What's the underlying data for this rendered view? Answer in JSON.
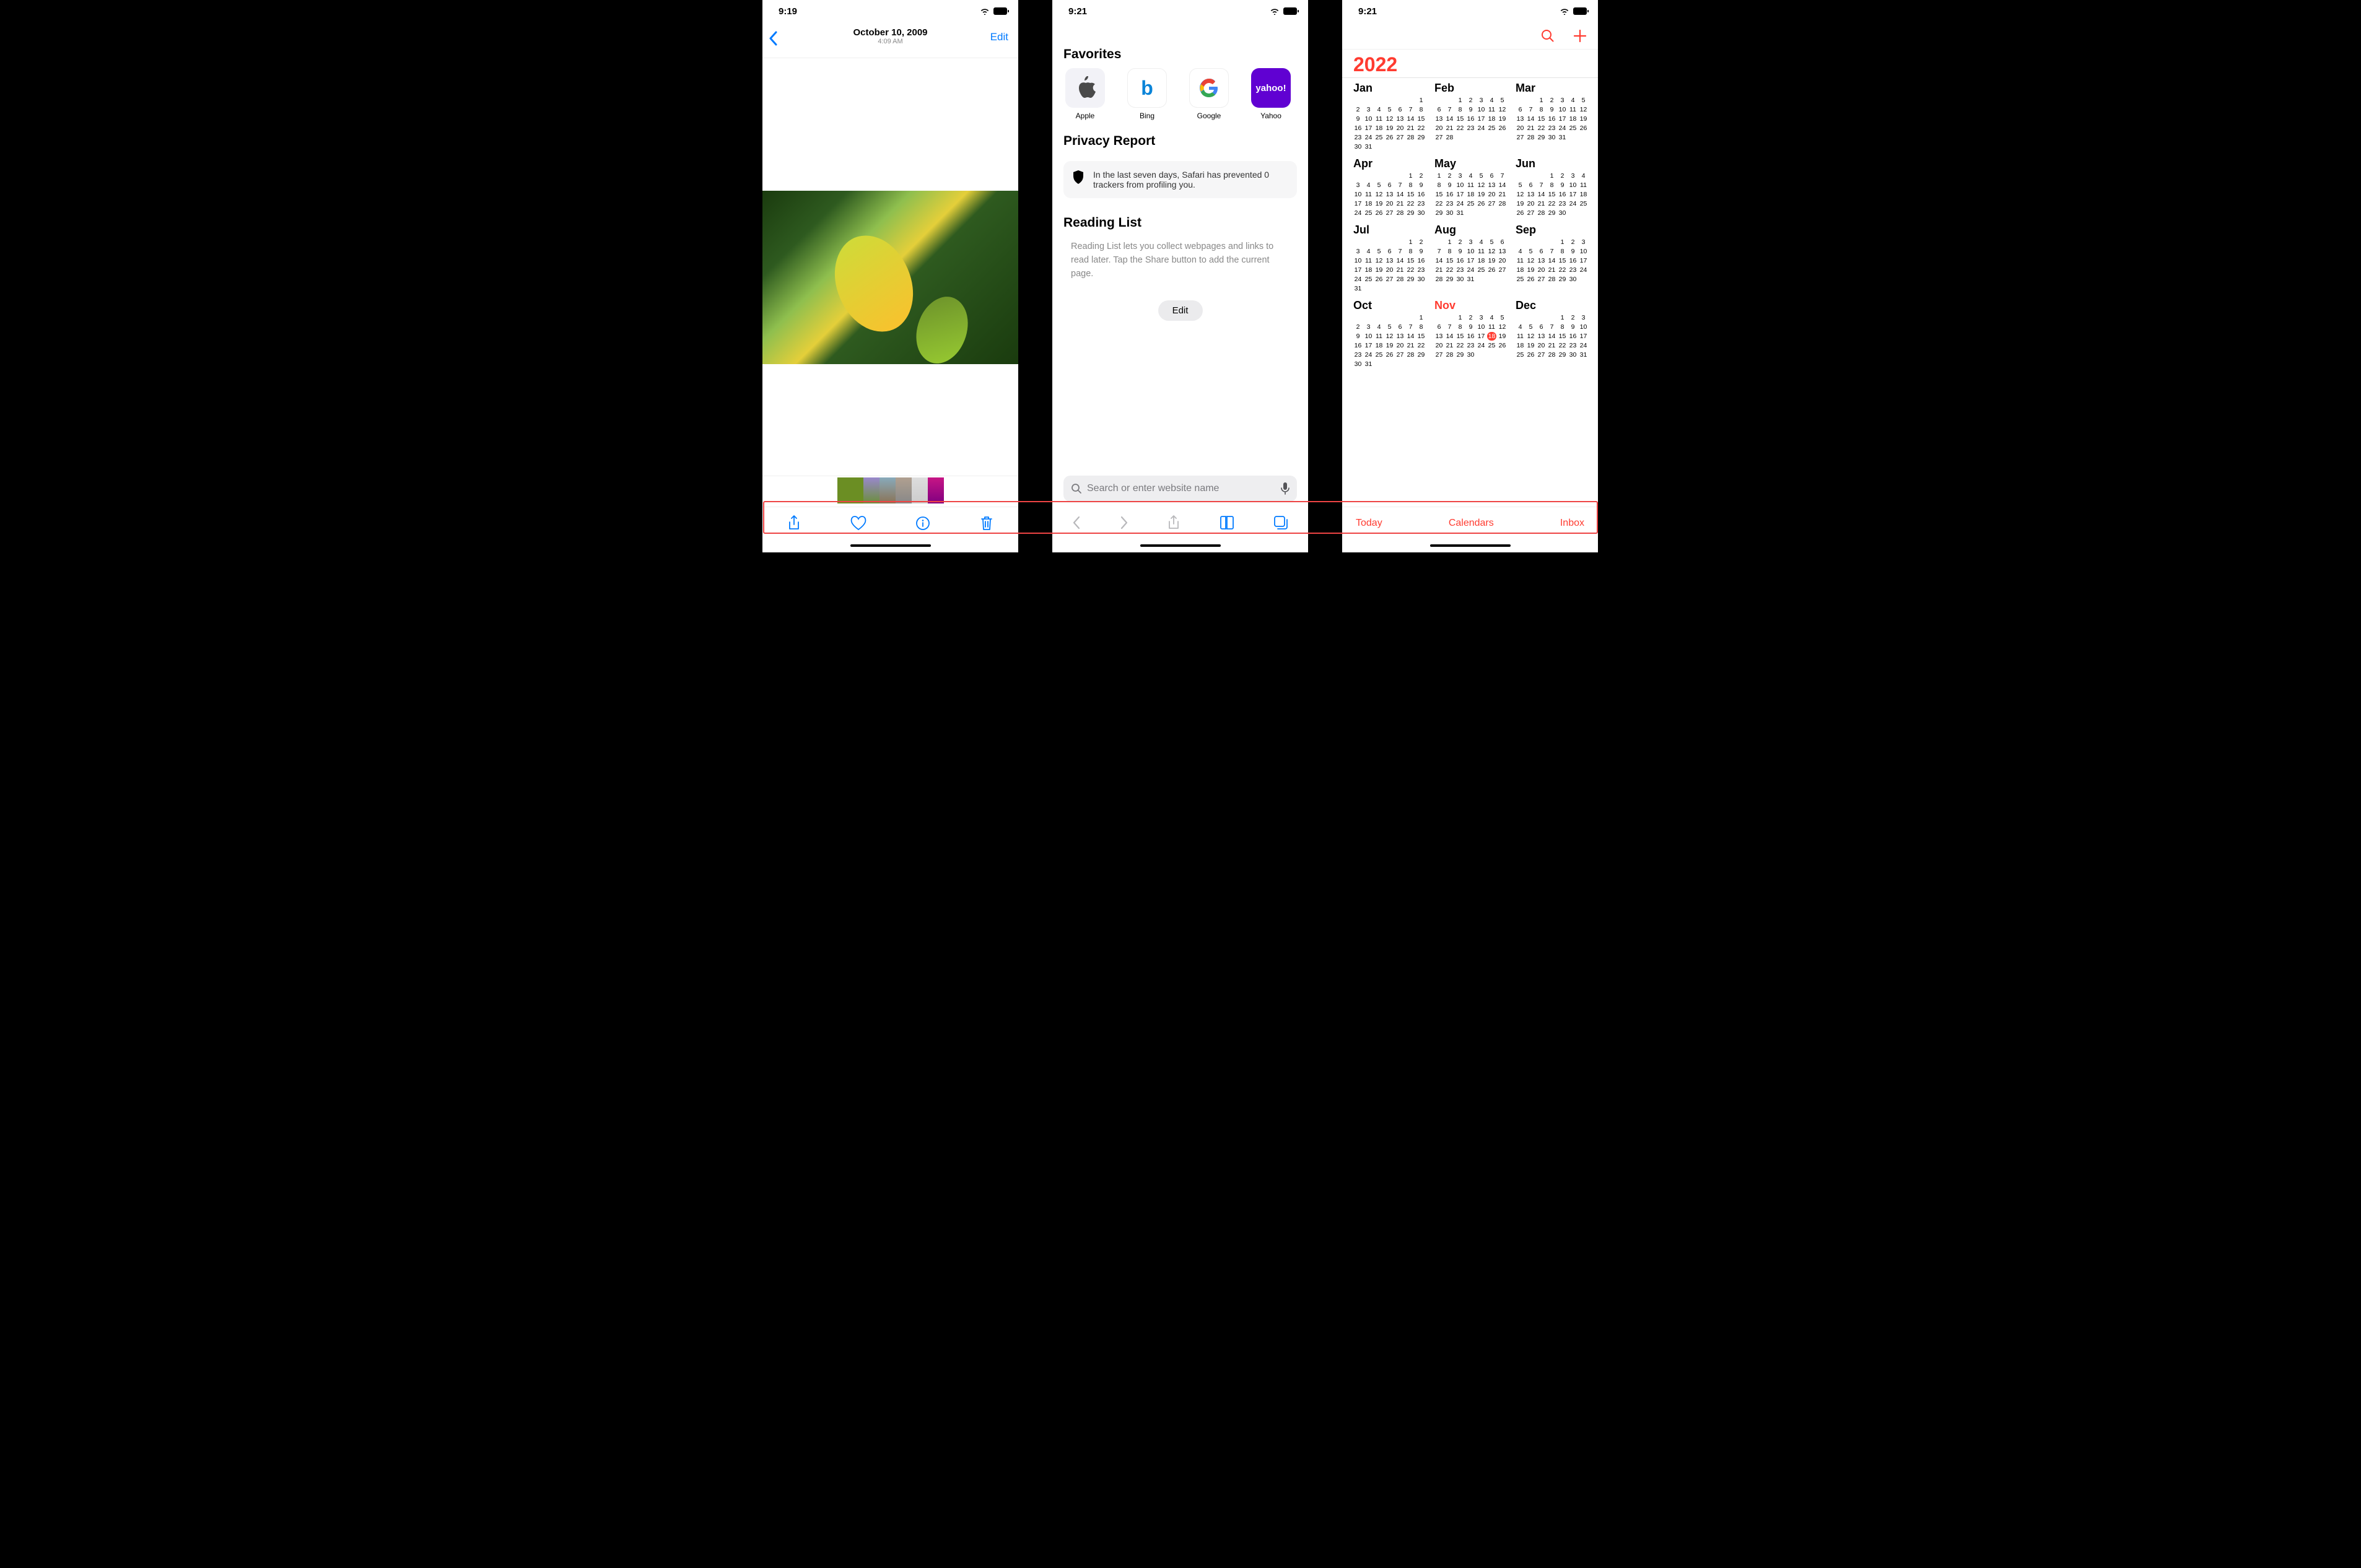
{
  "photos": {
    "status_time": "9:19",
    "title": "October 10, 2009",
    "subtitle": "4:09 AM",
    "edit_label": "Edit",
    "thumb_count": 6
  },
  "safari": {
    "status_time": "9:21",
    "section_favorites": "Favorites",
    "favorites": [
      {
        "label": "Apple"
      },
      {
        "label": "Bing"
      },
      {
        "label": "Google"
      },
      {
        "label": "Yahoo"
      }
    ],
    "section_privacy": "Privacy Report",
    "privacy_text": "In the last seven days, Safari has prevented 0 trackers from profiling you.",
    "section_reading": "Reading List",
    "reading_text": "Reading List lets you collect webpages and links to read later. Tap the Share button to add the current page.",
    "edit_label": "Edit",
    "search_placeholder": "Search or enter website name"
  },
  "calendar": {
    "status_time": "9:21",
    "year": "2022",
    "today_label": "Today",
    "calendars_label": "Calendars",
    "inbox_label": "Inbox",
    "current_month_index": 10,
    "today_day": 18,
    "months": [
      {
        "name": "Jan",
        "start": 6,
        "days": 31
      },
      {
        "name": "Feb",
        "start": 2,
        "days": 28
      },
      {
        "name": "Mar",
        "start": 2,
        "days": 31
      },
      {
        "name": "Apr",
        "start": 5,
        "days": 30
      },
      {
        "name": "May",
        "start": 0,
        "days": 31
      },
      {
        "name": "Jun",
        "start": 3,
        "days": 30
      },
      {
        "name": "Jul",
        "start": 5,
        "days": 31
      },
      {
        "name": "Aug",
        "start": 1,
        "days": 31
      },
      {
        "name": "Sep",
        "start": 4,
        "days": 30
      },
      {
        "name": "Oct",
        "start": 6,
        "days": 31
      },
      {
        "name": "Nov",
        "start": 2,
        "days": 30
      },
      {
        "name": "Dec",
        "start": 4,
        "days": 31
      }
    ]
  }
}
